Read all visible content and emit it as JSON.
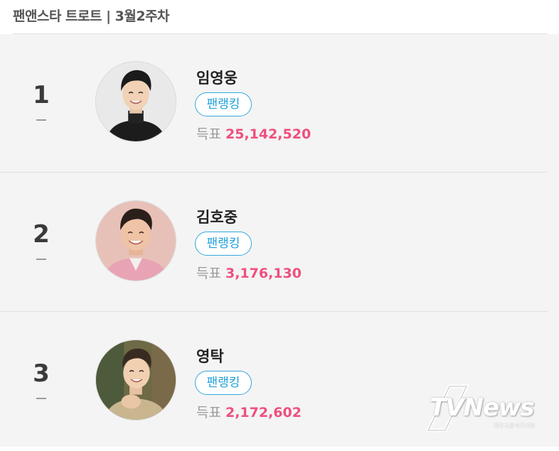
{
  "header": {
    "title": "팬앤스타 트로트 | 3월2주차"
  },
  "rankings": [
    {
      "rank": "1",
      "change_icon": "dash-icon",
      "name": "임영웅",
      "fan_button_label": "팬랭킹",
      "vote_label": "득표",
      "vote_count": "25,142,520"
    },
    {
      "rank": "2",
      "change_icon": "dash-icon",
      "name": "김호중",
      "fan_button_label": "팬랭킹",
      "vote_label": "득표",
      "vote_count": "3,176,130"
    },
    {
      "rank": "3",
      "change_icon": "dash-icon",
      "name": "영탁",
      "fan_button_label": "팬랭킹",
      "vote_label": "득표",
      "vote_count": "2,172,602"
    }
  ],
  "watermark": {
    "main": "TVNews",
    "sub": "제주교통복지신문"
  },
  "colors": {
    "vote_value": "#ef4f7e",
    "fan_button": "#1f9fd8",
    "list_background": "#f4f4f4"
  }
}
